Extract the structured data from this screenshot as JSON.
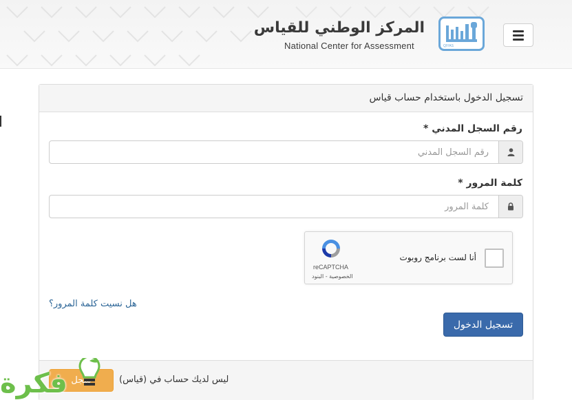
{
  "header": {
    "org_name_ar": "المركز الوطني للقياس",
    "org_name_en": "National Center for Assessment",
    "logo_small_text": "QIYAS",
    "menu_icon": "hamburger-icon"
  },
  "panel": {
    "title": "تسجيل الدخول باستخدام حساب قياس",
    "national_id": {
      "label": "رقم السجل المدني *",
      "placeholder": "رقم السجل المدني",
      "value": "",
      "icon": "user-icon"
    },
    "password": {
      "label": "كلمة المرور *",
      "placeholder": "كلمة المرور",
      "value": "",
      "icon": "lock-icon"
    },
    "recaptcha": {
      "label": "أنا لست برنامج روبوت",
      "brand": "reCAPTCHA",
      "terms": "الخصوصية - البنود",
      "checked": false
    },
    "forgot_password": "هل نسيت كلمة المرور؟",
    "login_button": "تسجيل الدخول",
    "footer": {
      "text": "ليس لديك حساب في (قياس)",
      "register_button": "سجل"
    }
  },
  "watermark": {
    "text": "فكرة"
  },
  "colors": {
    "primary": "#3a6aab",
    "warning": "#f0ad4e",
    "link": "#2a6496",
    "logo_blue": "#6aa7d9",
    "watermark_green": "#6dbf4b"
  }
}
